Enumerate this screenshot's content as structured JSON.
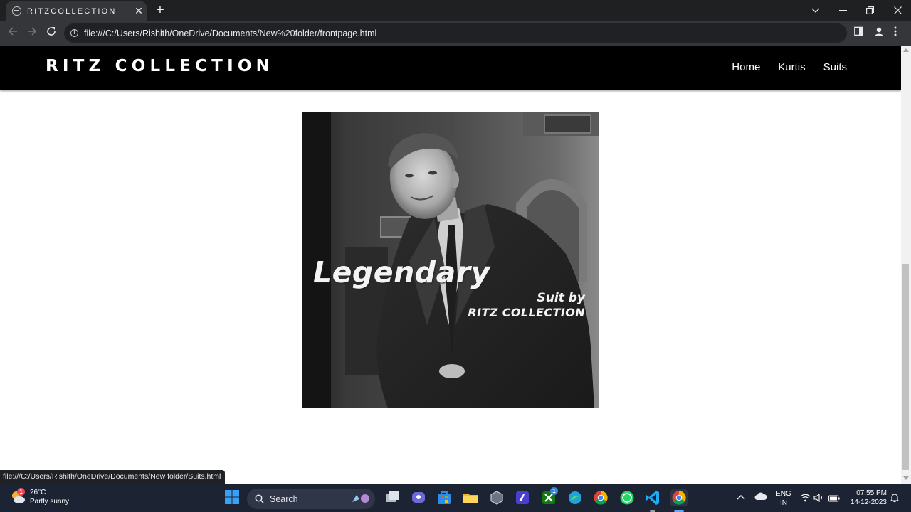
{
  "browser": {
    "tab_title": "RITZCOLLECTION",
    "url": "file:///C:/Users/Rishith/OneDrive/Documents/New%20folder/frontpage.html",
    "status_link": "file:///C:/Users/Rishith/OneDrive/Documents/New folder/Suits.html"
  },
  "site": {
    "brand": "RITZ COLLECTION",
    "nav": [
      "Home",
      "Kurtis",
      "Suits"
    ]
  },
  "hero": {
    "line1": "Legendary",
    "line2": "Suit by",
    "line3": "RITZ COLLECTION"
  },
  "taskbar": {
    "weather_temp": "26°C",
    "weather_desc": "Partly sunny",
    "weather_badge": "1",
    "search_label": "Search",
    "xbox_badge": "1",
    "lang_top": "ENG",
    "lang_bottom": "IN",
    "time": "07:55 PM",
    "date": "14-12-2023"
  },
  "colors": {
    "header_bg": "#000000",
    "tab_bg": "#35363a",
    "taskbar_bg": "#1c2333"
  }
}
